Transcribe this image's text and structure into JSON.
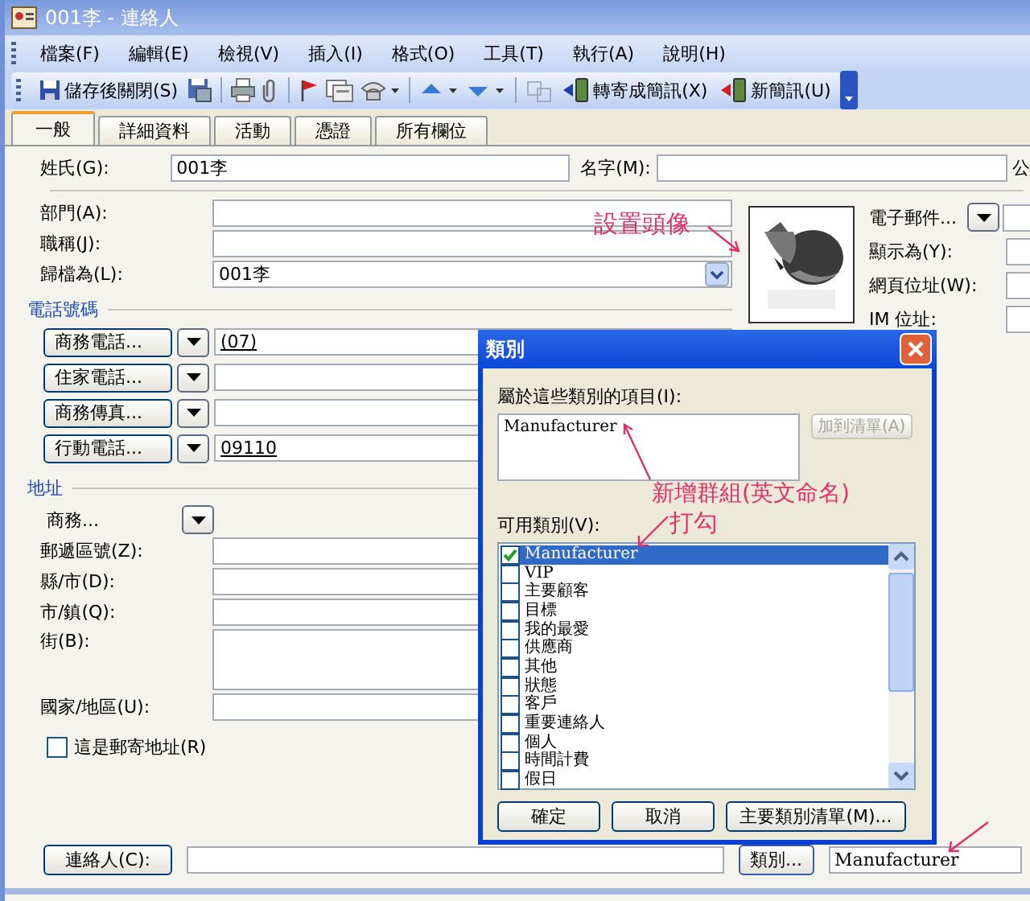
{
  "window": {
    "title": "001李 - 連絡人"
  },
  "menu": [
    "檔案(F)",
    "編輯(E)",
    "檢視(V)",
    "插入(I)",
    "格式(O)",
    "工具(T)",
    "執行(A)",
    "說明(H)"
  ],
  "toolbar": {
    "save_close": "儲存後關閉(S)",
    "forward_sms": "轉寄成簡訊(X)",
    "new_sms": "新簡訊(U)"
  },
  "tabs": [
    {
      "label": "一般",
      "selected": true
    },
    {
      "label": "詳細資料",
      "selected": false
    },
    {
      "label": "活動",
      "selected": false
    },
    {
      "label": "憑證",
      "selected": false
    },
    {
      "label": "所有欄位",
      "selected": false
    }
  ],
  "name_row": {
    "last_name_label": "姓氏(G):",
    "last_name": "001李",
    "first_name_label": "名字(M):",
    "company_label": "公"
  },
  "fields": [
    {
      "label": "部門(A):",
      "kind": "text"
    },
    {
      "label": "職稱(J):",
      "kind": "text"
    },
    {
      "label": "歸檔為(L):",
      "value": "001李",
      "kind": "combo"
    }
  ],
  "phone": {
    "title": "電話號碼",
    "rows": [
      {
        "label": "商務電話...",
        "value": "(07)"
      },
      {
        "label": "住家電話..."
      },
      {
        "label": "商務傳真..."
      },
      {
        "label": "行動電話...",
        "value": "09110"
      }
    ]
  },
  "address": {
    "title": "地址",
    "type": "商務...",
    "fields": [
      {
        "label": "郵遞區號(Z):",
        "kind": "line"
      },
      {
        "label": "縣/市(D):",
        "kind": "line"
      },
      {
        "label": "市/鎮(Q):",
        "kind": "line"
      },
      {
        "label": "街(B):",
        "kind": "multiline"
      },
      {
        "label": "國家/地區(U):",
        "kind": "line"
      }
    ],
    "mailing": {
      "label": "這是郵寄地址(R)",
      "checked": false
    }
  },
  "right": {
    "email_label": "電子郵件...",
    "fields": [
      {
        "label": "顯示為(Y):"
      },
      {
        "label": "網頁位址(W):"
      },
      {
        "label": "IM 位址:"
      }
    ]
  },
  "bottom": {
    "contacts_button": "連絡人(C):",
    "categories_button": "類別...",
    "categories_value": "Manufacturer"
  },
  "dialog": {
    "title": "類別",
    "items_label": "屬於這些類別的項目(I):",
    "items_value": "Manufacturer",
    "add_button": {
      "label": "加到清單(A)",
      "disabled": true
    },
    "available_label": "可用類別(V):",
    "categories": [
      {
        "name": "Manufacturer",
        "checked": true,
        "selected": true
      },
      {
        "name": "VIP",
        "checked": false,
        "selected": false
      },
      {
        "name": "主要顧客",
        "checked": false,
        "selected": false
      },
      {
        "name": "目標",
        "checked": false,
        "selected": false
      },
      {
        "name": "我的最愛",
        "checked": false,
        "selected": false
      },
      {
        "name": "供應商",
        "checked": false,
        "selected": false
      },
      {
        "name": "其他",
        "checked": false,
        "selected": false
      },
      {
        "name": "狀態",
        "checked": false,
        "selected": false
      },
      {
        "name": "客戶",
        "checked": false,
        "selected": false
      },
      {
        "name": "重要連絡人",
        "checked": false,
        "selected": false
      },
      {
        "name": "個人",
        "checked": false,
        "selected": false
      },
      {
        "name": "時間計費",
        "checked": false,
        "selected": false
      },
      {
        "name": "假日",
        "checked": false,
        "selected": false
      }
    ],
    "buttons": [
      "確定",
      "取消",
      "主要類別清單(M)..."
    ]
  },
  "annotations": [
    {
      "text": "設置頭像"
    },
    {
      "text": "新增群組(英文命名)"
    },
    {
      "text": "打勾"
    }
  ]
}
